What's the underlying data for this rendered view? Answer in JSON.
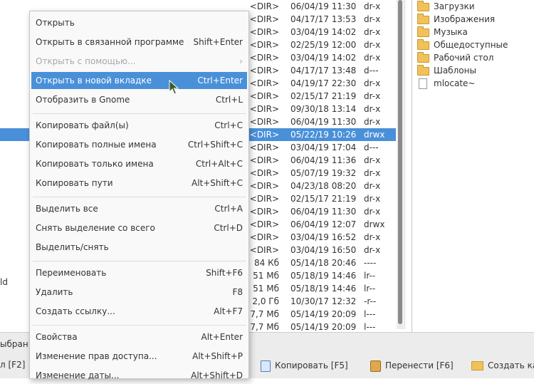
{
  "file_rows": [
    {
      "size": "<DIR>",
      "date": "06/04/19 11:30",
      "attr": "dr-x",
      "selected": false
    },
    {
      "size": "<DIR>",
      "date": "04/17/17 13:53",
      "attr": "dr-x",
      "selected": false
    },
    {
      "size": "<DIR>",
      "date": "03/04/19 14:02",
      "attr": "dr-x",
      "selected": false
    },
    {
      "size": "<DIR>",
      "date": "02/25/19 12:00",
      "attr": "dr-x",
      "selected": false
    },
    {
      "size": "<DIR>",
      "date": "03/04/19 14:02",
      "attr": "dr-x",
      "selected": false
    },
    {
      "size": "<DIR>",
      "date": "04/17/17 13:48",
      "attr": "d---",
      "selected": false
    },
    {
      "size": "<DIR>",
      "date": "04/19/17 22:30",
      "attr": "dr-x",
      "selected": false
    },
    {
      "size": "<DIR>",
      "date": "02/15/17 21:19",
      "attr": "dr-x",
      "selected": false
    },
    {
      "size": "<DIR>",
      "date": "09/30/18 13:14",
      "attr": "dr-x",
      "selected": false
    },
    {
      "size": "<DIR>",
      "date": "06/04/19 11:30",
      "attr": "dr-x",
      "selected": false
    },
    {
      "size": "<DIR>",
      "date": "05/22/19 10:26",
      "attr": "drwx",
      "selected": true
    },
    {
      "size": "<DIR>",
      "date": "03/04/19 17:04",
      "attr": "d---",
      "selected": false
    },
    {
      "size": "<DIR>",
      "date": "06/04/19 11:36",
      "attr": "dr-x",
      "selected": false
    },
    {
      "size": "<DIR>",
      "date": "05/07/19 19:32",
      "attr": "dr-x",
      "selected": false
    },
    {
      "size": "<DIR>",
      "date": "04/23/18 08:20",
      "attr": "dr-x",
      "selected": false
    },
    {
      "size": "<DIR>",
      "date": "02/15/17 21:19",
      "attr": "dr-x",
      "selected": false
    },
    {
      "size": "<DIR>",
      "date": "06/04/19 11:30",
      "attr": "dr-x",
      "selected": false
    },
    {
      "size": "<DIR>",
      "date": "06/04/19 12:07",
      "attr": "drwx",
      "selected": false
    },
    {
      "size": "<DIR>",
      "date": "03/04/19 16:52",
      "attr": "dr-x",
      "selected": false
    },
    {
      "size": "<DIR>",
      "date": "03/04/19 16:50",
      "attr": "dr-x",
      "selected": false
    },
    {
      "size": "84 Кб",
      "date": "05/14/18 20:46",
      "attr": "----",
      "selected": false
    },
    {
      "size": "51 Мб",
      "date": "05/18/19 14:46",
      "attr": "lr--",
      "selected": false
    },
    {
      "size": "51 Мб",
      "date": "05/18/19 14:46",
      "attr": "lr--",
      "selected": false
    },
    {
      "size": "2,0 Гб",
      "date": "10/30/17 12:32",
      "attr": "-r--",
      "selected": false
    },
    {
      "size": "7,7 Мб",
      "date": "05/14/19 20:09",
      "attr": "l---",
      "selected": false
    },
    {
      "size": "7,7 Мб",
      "date": "05/14/19 20:09",
      "attr": "l---",
      "selected": false
    }
  ],
  "left_fragments": {
    "row_fragment": "ld"
  },
  "tree_items": [
    {
      "label": "Загрузки",
      "icon": "folder-icon"
    },
    {
      "label": "Изображения",
      "icon": "folder-icon"
    },
    {
      "label": "Музыка",
      "icon": "folder-icon"
    },
    {
      "label": "Общедоступные",
      "icon": "folder-icon"
    },
    {
      "label": "Рабочий стол",
      "icon": "folder-icon"
    },
    {
      "label": "Шаблоны",
      "icon": "folder-icon"
    },
    {
      "label": "mlocate~",
      "icon": "file-icon"
    }
  ],
  "bottom": {
    "status_fragment": "ыбран",
    "f2_fragment": "л [F2]",
    "copy_label": "Копировать [F5]",
    "move_label": "Перенести [F6]",
    "newdir_label": "Создать кат"
  },
  "menu": [
    {
      "label": "Открыть",
      "shortcut": ""
    },
    {
      "label": "Открыть в связанной программе",
      "shortcut": "Shift+Enter"
    },
    {
      "label": "Открыть с помощью...",
      "shortcut": "›",
      "disabled": true
    },
    {
      "label": "Открыть в новой вкладке",
      "shortcut": "Ctrl+Enter",
      "highlighted": true
    },
    {
      "label": "Отобразить в Gnome",
      "shortcut": "Ctrl+L"
    },
    {
      "sep": true
    },
    {
      "label": "Копировать файл(ы)",
      "shortcut": "Ctrl+C"
    },
    {
      "label": "Копировать полные имена",
      "shortcut": "Ctrl+Shift+C"
    },
    {
      "label": "Копировать только имена",
      "shortcut": "Ctrl+Alt+C"
    },
    {
      "label": "Копировать пути",
      "shortcut": "Alt+Shift+C"
    },
    {
      "sep": true
    },
    {
      "label": "Выделить все",
      "shortcut": "Ctrl+A"
    },
    {
      "label": "Снять выделение со всего",
      "shortcut": "Ctrl+D"
    },
    {
      "label": "Выделить/снять",
      "shortcut": ""
    },
    {
      "sep": true
    },
    {
      "label": "Переименовать",
      "shortcut": "Shift+F6"
    },
    {
      "label": "Удалить",
      "shortcut": "F8"
    },
    {
      "label": "Создать ссылку...",
      "shortcut": "Alt+F7"
    },
    {
      "sep": true
    },
    {
      "label": "Свойства",
      "shortcut": "Alt+Enter"
    },
    {
      "label": "Изменение прав доступа...",
      "shortcut": "Alt+Shift+P"
    },
    {
      "label": "Изменение даты...",
      "shortcut": "Alt+Shift+D"
    }
  ],
  "colors": {
    "selection": "#4a90d9",
    "menu_bg": "#f9f9f9"
  }
}
